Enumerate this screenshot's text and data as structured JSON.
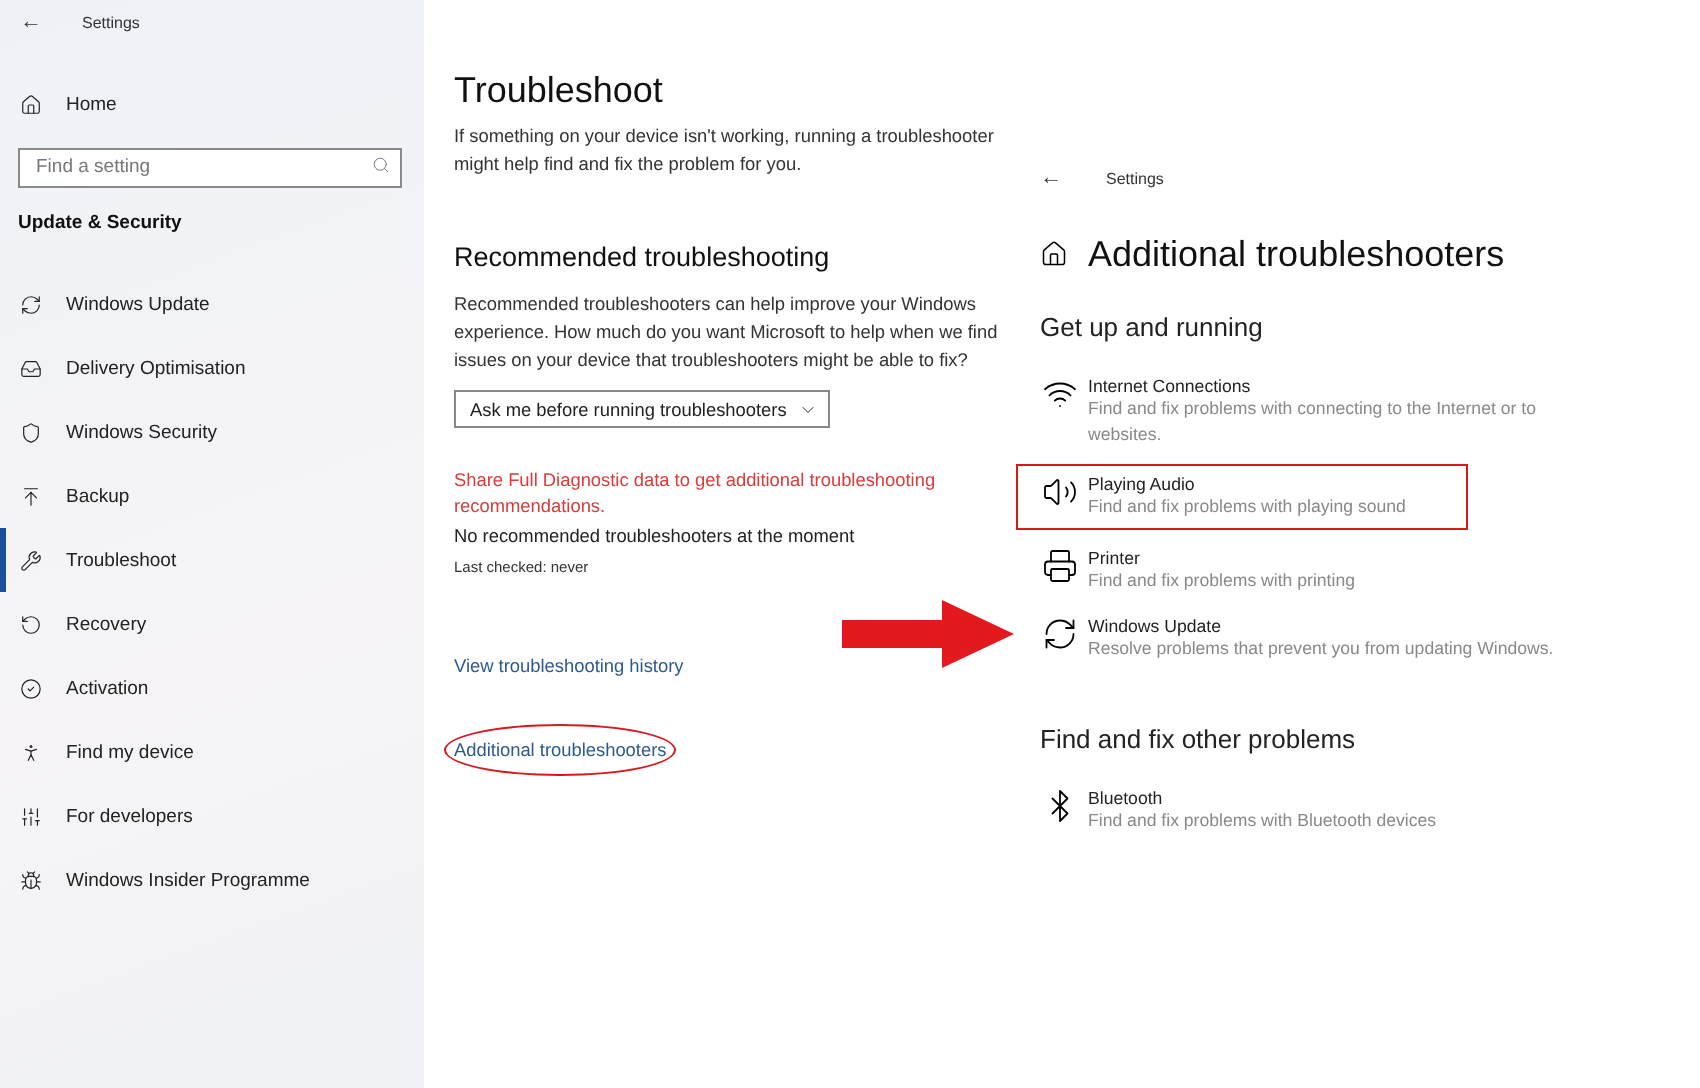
{
  "sidebar": {
    "back": "←",
    "title": "Settings",
    "home": "Home",
    "search": {
      "placeholder": "Find a setting"
    },
    "section": "Update & Security",
    "items": [
      {
        "label": "Windows Update",
        "selected": false
      },
      {
        "label": "Delivery Optimisation",
        "selected": false
      },
      {
        "label": "Windows Security",
        "selected": false
      },
      {
        "label": "Backup",
        "selected": false
      },
      {
        "label": "Troubleshoot",
        "selected": true
      },
      {
        "label": "Recovery",
        "selected": false
      },
      {
        "label": "Activation",
        "selected": false
      },
      {
        "label": "Find my device",
        "selected": false
      },
      {
        "label": "For developers",
        "selected": false
      },
      {
        "label": "Windows Insider Programme",
        "selected": false
      }
    ]
  },
  "main": {
    "title": "Troubleshoot",
    "intro": "If something on your device isn't working, running a troubleshooter might help find and fix the problem for you.",
    "heading": "Recommended troubleshooting",
    "description": "Recommended troubleshooters can help improve your Windows experience. How much do you want Microsoft to help when we find issues on your device that troubleshooters might be able to fix?",
    "dropdown": "Ask me before running troubleshooters",
    "diagnostic_link": "Share Full Diagnostic data to get additional troubleshooting recommendations.",
    "status": "No recommended troubleshooters at the moment",
    "last_checked": "Last checked: never",
    "links": [
      {
        "label": "View troubleshooting history",
        "circled": false
      },
      {
        "label": "Additional troubleshooters",
        "circled": true
      }
    ]
  },
  "overlay": {
    "back": "←",
    "title": "Settings",
    "heading": "Additional troubleshooters",
    "sections": [
      {
        "title": "Get up and running",
        "items": [
          {
            "kind": "wifi",
            "title": "Internet Connections",
            "description": "Find and fix problems with connecting to the Internet or to websites.",
            "highlighted": false
          },
          {
            "kind": "audio",
            "title": "Playing Audio",
            "description": "Find and fix problems with playing sound",
            "highlighted": true
          },
          {
            "kind": "printer",
            "title": "Printer",
            "description": "Find and fix problems with printing",
            "highlighted": false
          },
          {
            "kind": "update",
            "title": "Windows Update",
            "description": "Resolve problems that prevent you from updating Windows.",
            "highlighted": false
          }
        ]
      },
      {
        "title": "Find and fix other problems",
        "items": [
          {
            "kind": "bluetooth",
            "title": "Bluetooth",
            "description": "Find and fix problems with Bluetooth devices",
            "highlighted": false
          }
        ]
      }
    ]
  }
}
